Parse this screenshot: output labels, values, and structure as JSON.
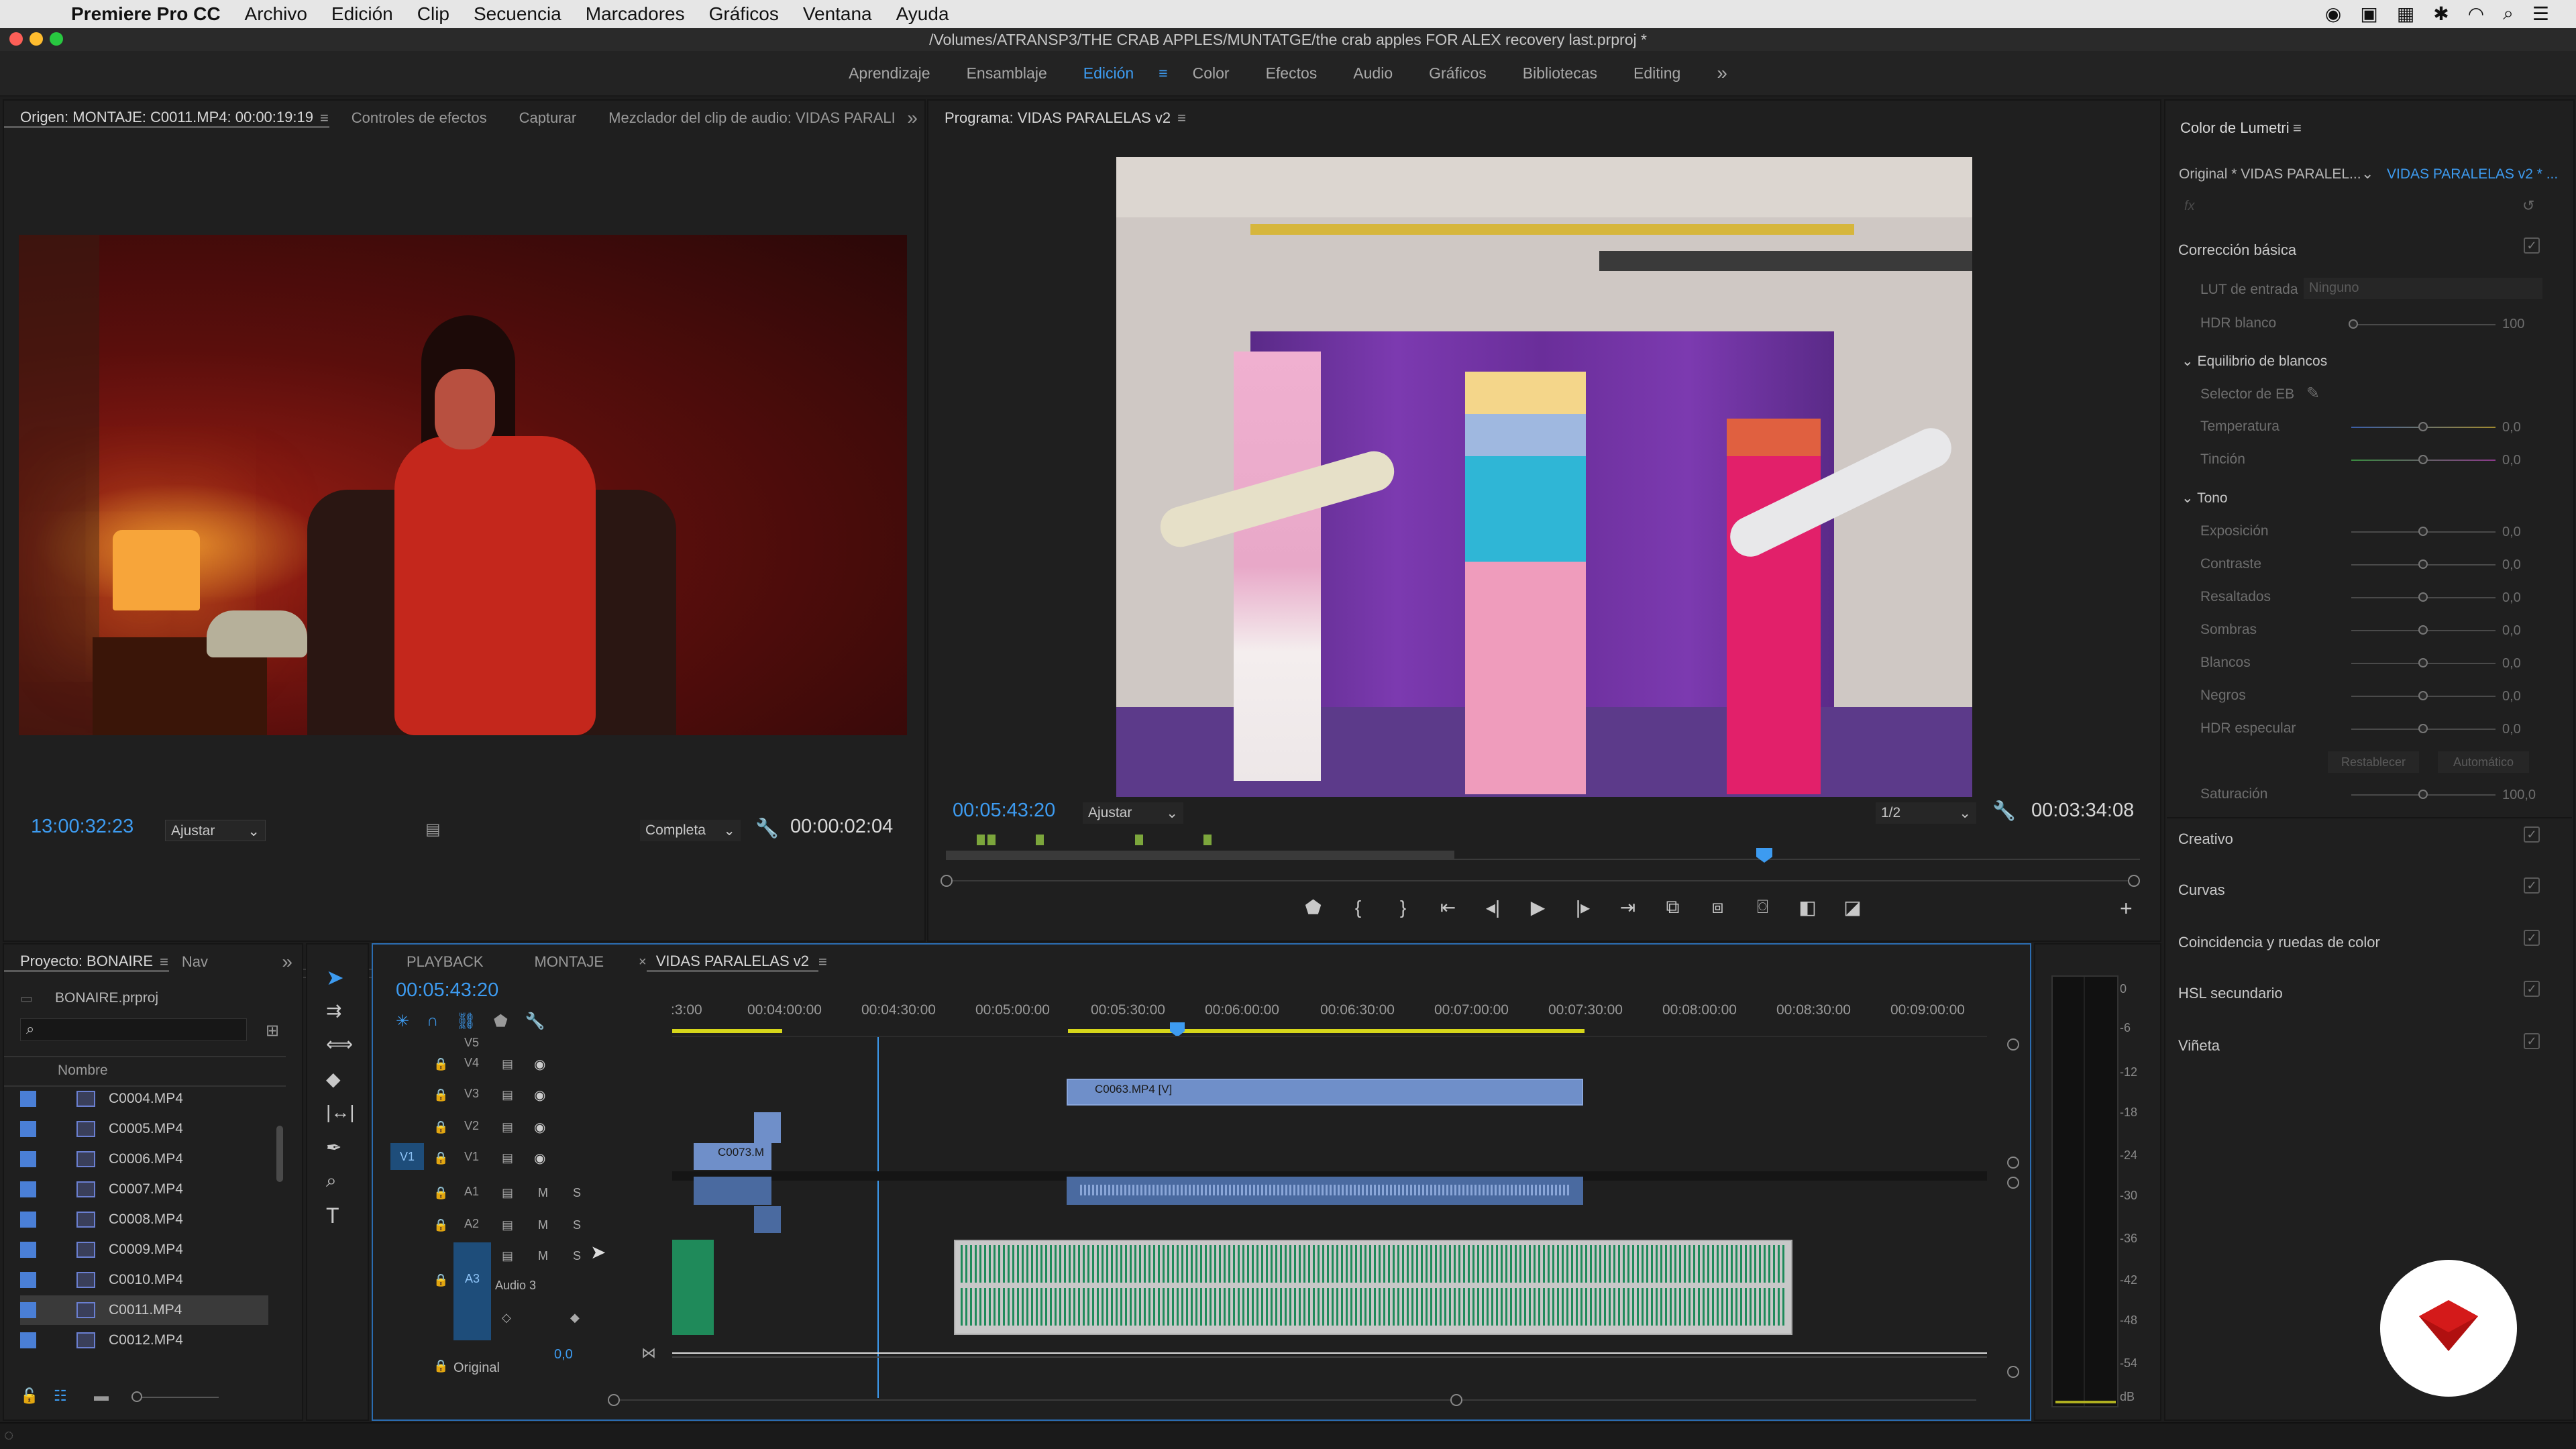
{
  "menubar": {
    "app": "Premiere Pro CC",
    "items": [
      "Archivo",
      "Edición",
      "Clip",
      "Secuencia",
      "Marcadores",
      "Gráficos",
      "Ventana",
      "Ayuda"
    ]
  },
  "window": {
    "title": "/Volumes/ATRANSP3/THE CRAB APPLES/MUNTATGE/the crab apples FOR ALEX recovery last.prproj *"
  },
  "workspaces": {
    "items": [
      "Aprendizaje",
      "Ensamblaje",
      "Edición",
      "Color",
      "Efectos",
      "Audio",
      "Gráficos",
      "Bibliotecas",
      "Editing"
    ],
    "active": "Edición",
    "overflow": "»"
  },
  "source": {
    "tabs": [
      "Origen: MONTAJE: C0011.MP4: 00:00:19:19",
      "Controles de efectos",
      "Capturar",
      "Mezclador del clip de audio: VIDAS PARALI"
    ],
    "timecode": "13:00:32:23",
    "fit": "Ajustar",
    "resolution": "Completa",
    "duration": "00:00:02:04"
  },
  "program": {
    "tab": "Programa: VIDAS PARALELAS v2",
    "timecode": "00:05:43:20",
    "fit": "Ajustar",
    "resolution": "1/2",
    "duration": "00:03:34:08"
  },
  "lumetri": {
    "title": "Color de Lumetri",
    "master": "Original * VIDAS PARALEL...",
    "clip": "VIDAS PARALELAS v2 * ...",
    "fx": "fx",
    "basic": "Corrección básica",
    "lut_label": "LUT de entrada",
    "lut_value": "Ninguno",
    "hdr_label": "HDR blanco",
    "hdr_value": "100",
    "wb_header": "Equilibrio de blancos",
    "wb_selector": "Selector de EB",
    "tone_header": "Tono",
    "sliders": [
      {
        "label": "Temperatura",
        "value": "0,0"
      },
      {
        "label": "Tinción",
        "value": "0,0"
      },
      {
        "label": "Exposición",
        "value": "0,0"
      },
      {
        "label": "Contraste",
        "value": "0,0"
      },
      {
        "label": "Resaltados",
        "value": "0,0"
      },
      {
        "label": "Sombras",
        "value": "0,0"
      },
      {
        "label": "Blancos",
        "value": "0,0"
      },
      {
        "label": "Negros",
        "value": "0,0"
      },
      {
        "label": "HDR especular",
        "value": "0,0"
      }
    ],
    "reset": "Restablecer",
    "auto": "Automático",
    "saturation_label": "Saturación",
    "saturation_value": "100,0",
    "sections": [
      "Creativo",
      "Curvas",
      "Coincidencia y ruedas de color",
      "HSL secundario",
      "Viñeta"
    ]
  },
  "project": {
    "tabs": [
      "Proyecto: BONAIRE",
      "Nav"
    ],
    "file": "BONAIRE.prproj",
    "column": "Nombre",
    "items": [
      "C0004.MP4",
      "C0005.MP4",
      "C0006.MP4",
      "C0007.MP4",
      "C0008.MP4",
      "C0009.MP4",
      "C0010.MP4",
      "C0011.MP4",
      "C0012.MP4"
    ],
    "selected": "C0011.MP4"
  },
  "timeline": {
    "tabs": [
      "PLAYBACK",
      "MONTAJE",
      "VIDAS PARALELAS v2"
    ],
    "timecode": "00:05:43:20",
    "ruler": [
      ":3:00",
      "00:04:00:00",
      "00:04:30:00",
      "00:05:00:00",
      "00:05:30:00",
      "00:06:00:00",
      "00:06:30:00",
      "00:07:00:00",
      "00:07:30:00",
      "00:08:00:00",
      "00:08:30:00",
      "00:09:00:00"
    ],
    "tracks": [
      "V5",
      "V4",
      "V3",
      "V2",
      "V1",
      "A1",
      "A2",
      "A3"
    ],
    "v1_target": "V1",
    "a3_target": "A3",
    "audio3_name": "Audio 3",
    "vol_value": "0,0",
    "original_label": "Original",
    "clips": {
      "c0063": "C0063.MP4 [V]",
      "c0073": "C0073.M"
    },
    "m": "M",
    "s": "S"
  },
  "meter": {
    "labels": [
      "0",
      "-6",
      "-12",
      "-18",
      "-24",
      "-30",
      "-36",
      "-42",
      "-48",
      "-54",
      "dB"
    ]
  },
  "colors": {
    "accent": "#3d9bf0",
    "clip_blue": "#6f8fc9",
    "audio_green": "#1f8a5a",
    "logo_red": "#d41a1a"
  }
}
